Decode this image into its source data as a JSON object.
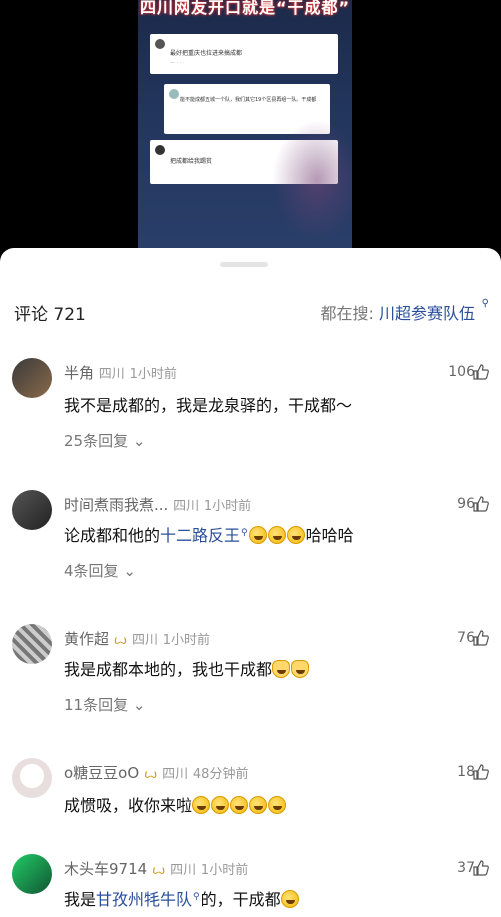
{
  "video": {
    "title": "四川网友开口就是“干成都”",
    "cards": [
      {
        "text": "最好把重庆也拉进来搞成都"
      },
      {
        "text": "能不能成都五城一个队，我们其它19个区县再组一队。干成都"
      },
      {
        "text": "把成都给我踢贫"
      }
    ]
  },
  "header": {
    "comment_count": "评论 721",
    "search_prefix": "都在搜: ",
    "search_topic": "川超参赛队伍"
  },
  "comments": [
    {
      "user": "半角",
      "badge": "",
      "location": "四川",
      "time": "1小时前",
      "text": "我不是成都的，我是龙泉驿的，干成都～",
      "replies": "25条回复",
      "likes": "106"
    },
    {
      "user": "时间煮雨我煮...",
      "badge": "",
      "location": "四川",
      "time": "1小时前",
      "text_before": "论成都和他的",
      "link": "十二路反王",
      "text_after": "哈哈哈",
      "replies": "4条回复",
      "likes": "96"
    },
    {
      "user": "黄作超",
      "badge": "ꙍ",
      "location": "四川",
      "time": "1小时前",
      "text": "我是成都本地的，我也干成都",
      "replies": "11条回复",
      "likes": "76"
    },
    {
      "user": "o糖豆豆oO",
      "badge": "ꙍ",
      "location": "四川",
      "time": "48分钟前",
      "text": "成惯吸，收你来啦",
      "replies": "",
      "likes": "18"
    },
    {
      "user": "木头车9714",
      "badge": "ꙍ",
      "location": "四川",
      "time": "1小时前",
      "text_before": "我是",
      "link": "甘孜州牦牛队",
      "text_after": "的，干成都",
      "replies": "",
      "likes": "37"
    }
  ]
}
